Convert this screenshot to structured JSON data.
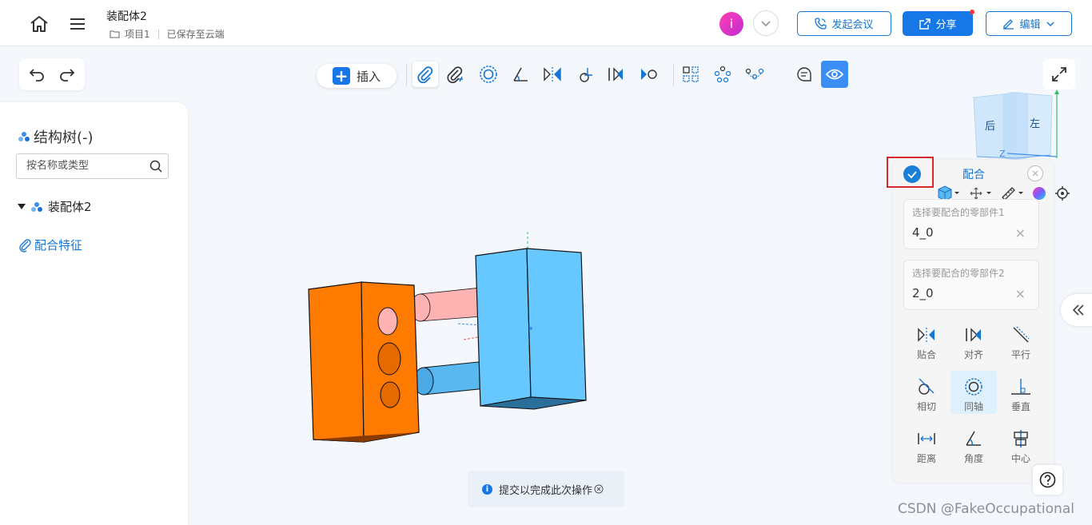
{
  "header": {
    "doc_title": "装配体2",
    "project": "项目1",
    "save_status": "已保存至云端",
    "avatar_letter": "i",
    "meeting_label": "发起会议",
    "share_label": "分享",
    "edit_label": "编辑"
  },
  "toolbar": {
    "insert_label": "插入"
  },
  "tree": {
    "title": "结构树(-)",
    "search_placeholder": "按名称或类型",
    "root": "装配体2",
    "mate_feature": "配合特征"
  },
  "viewcube": {
    "back_face": "后",
    "left_face": "左",
    "z_axis": "Z"
  },
  "mate_panel": {
    "title": "配合",
    "part1_label": "选择要配合的零部件1",
    "part1_value": "4_0",
    "part2_label": "选择要配合的零部件2",
    "part2_value": "2_0",
    "types": [
      "贴合",
      "对齐",
      "平行",
      "相切",
      "同轴",
      "垂直",
      "距离",
      "角度",
      "中心"
    ],
    "selected_type": "同轴"
  },
  "tip": {
    "text": "提交以完成此次操作"
  },
  "watermark": "CSDN @FakeOccupational",
  "colors": {
    "accent": "#1677e6",
    "orange_part": "#ff7a00",
    "blue_part": "#66c8ff",
    "pink_pin": "#ffb3b3",
    "blue_pin": "#5ab8f0"
  }
}
